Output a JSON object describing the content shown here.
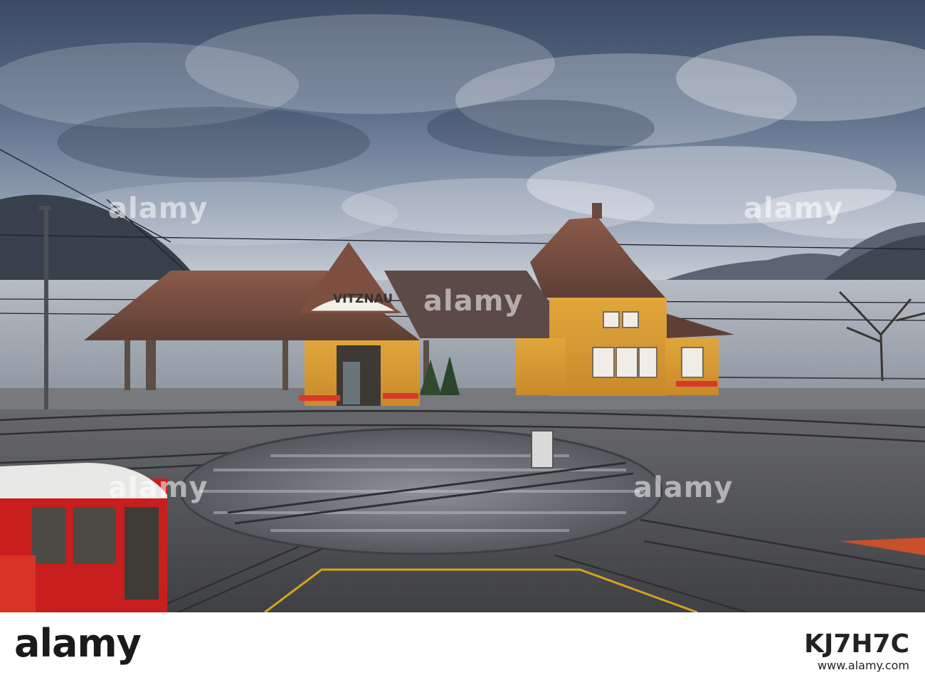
{
  "photo": {
    "station_sign": "VITZNAU"
  },
  "watermarks": [
    "alamy",
    "alamy",
    "alamy",
    "alamy",
    "alamy"
  ],
  "footer": {
    "logo": "alamy",
    "site": "www.alamy.com",
    "image_id": "KJ7H7C"
  }
}
